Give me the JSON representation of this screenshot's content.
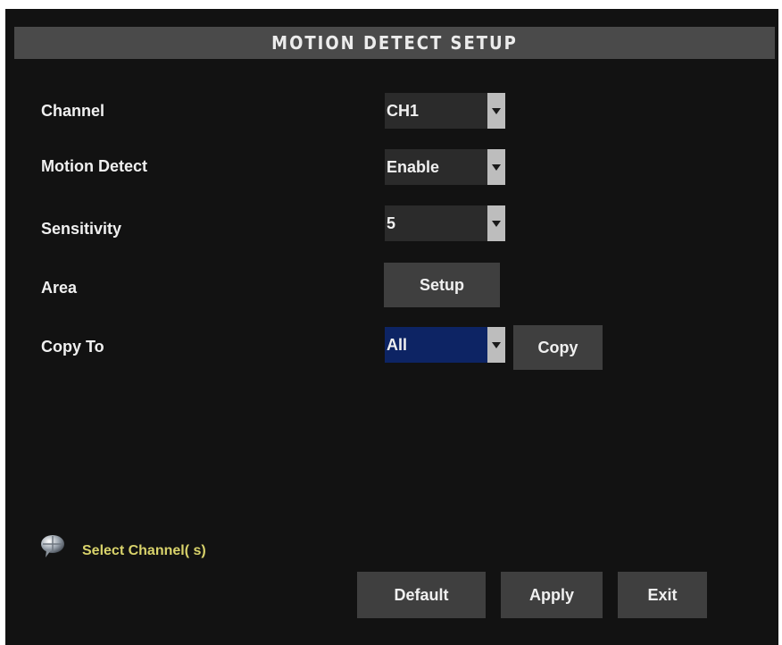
{
  "title": "MOTION DETECT SETUP",
  "rows": [
    {
      "label": "Channel",
      "value": "CH1"
    },
    {
      "label": "Motion Detect",
      "value": "Enable"
    },
    {
      "label": "Sensitivity",
      "value": "5"
    },
    {
      "label": "Area",
      "button": "Setup"
    },
    {
      "label": "Copy To",
      "value": "All",
      "button": "Copy"
    }
  ],
  "hint": "Select Channel( s)",
  "footer": {
    "default_label": "Default",
    "apply_label": "Apply",
    "exit_label": "Exit"
  },
  "colors": {
    "background": "#121212",
    "title_bar": "#4a4a4a",
    "hint_text": "#d9d36b",
    "selected": "#0d2464"
  },
  "icons": {
    "dropdown": "chevron-down-icon",
    "hint": "info-icon"
  }
}
